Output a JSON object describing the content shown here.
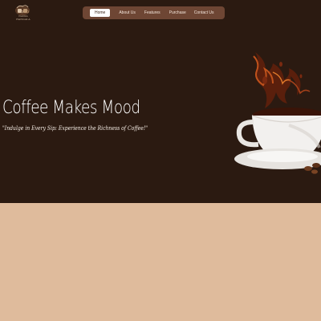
{
  "brand": {
    "logo_text": "NADIA HANGALA",
    "logo_icon": "coffee-cups-icon"
  },
  "nav": {
    "items": [
      {
        "label": "Home",
        "active": true
      },
      {
        "label": "About Us",
        "active": false
      },
      {
        "label": "Features",
        "active": false
      },
      {
        "label": "Purchase",
        "active": false
      },
      {
        "label": "Contact Us",
        "active": false
      }
    ]
  },
  "hero": {
    "title": "Coffee Makes Mood",
    "tagline": "\"Indulge in Every Sip: Experience the Richness of Coffee!\"",
    "image_icon": "coffee-cup-splash-icon"
  },
  "colors": {
    "hero_bg": "#2b1a11",
    "nav_bg": "#6e4634",
    "lower_bg": "#dfbb9c",
    "text": "#ffffff"
  }
}
